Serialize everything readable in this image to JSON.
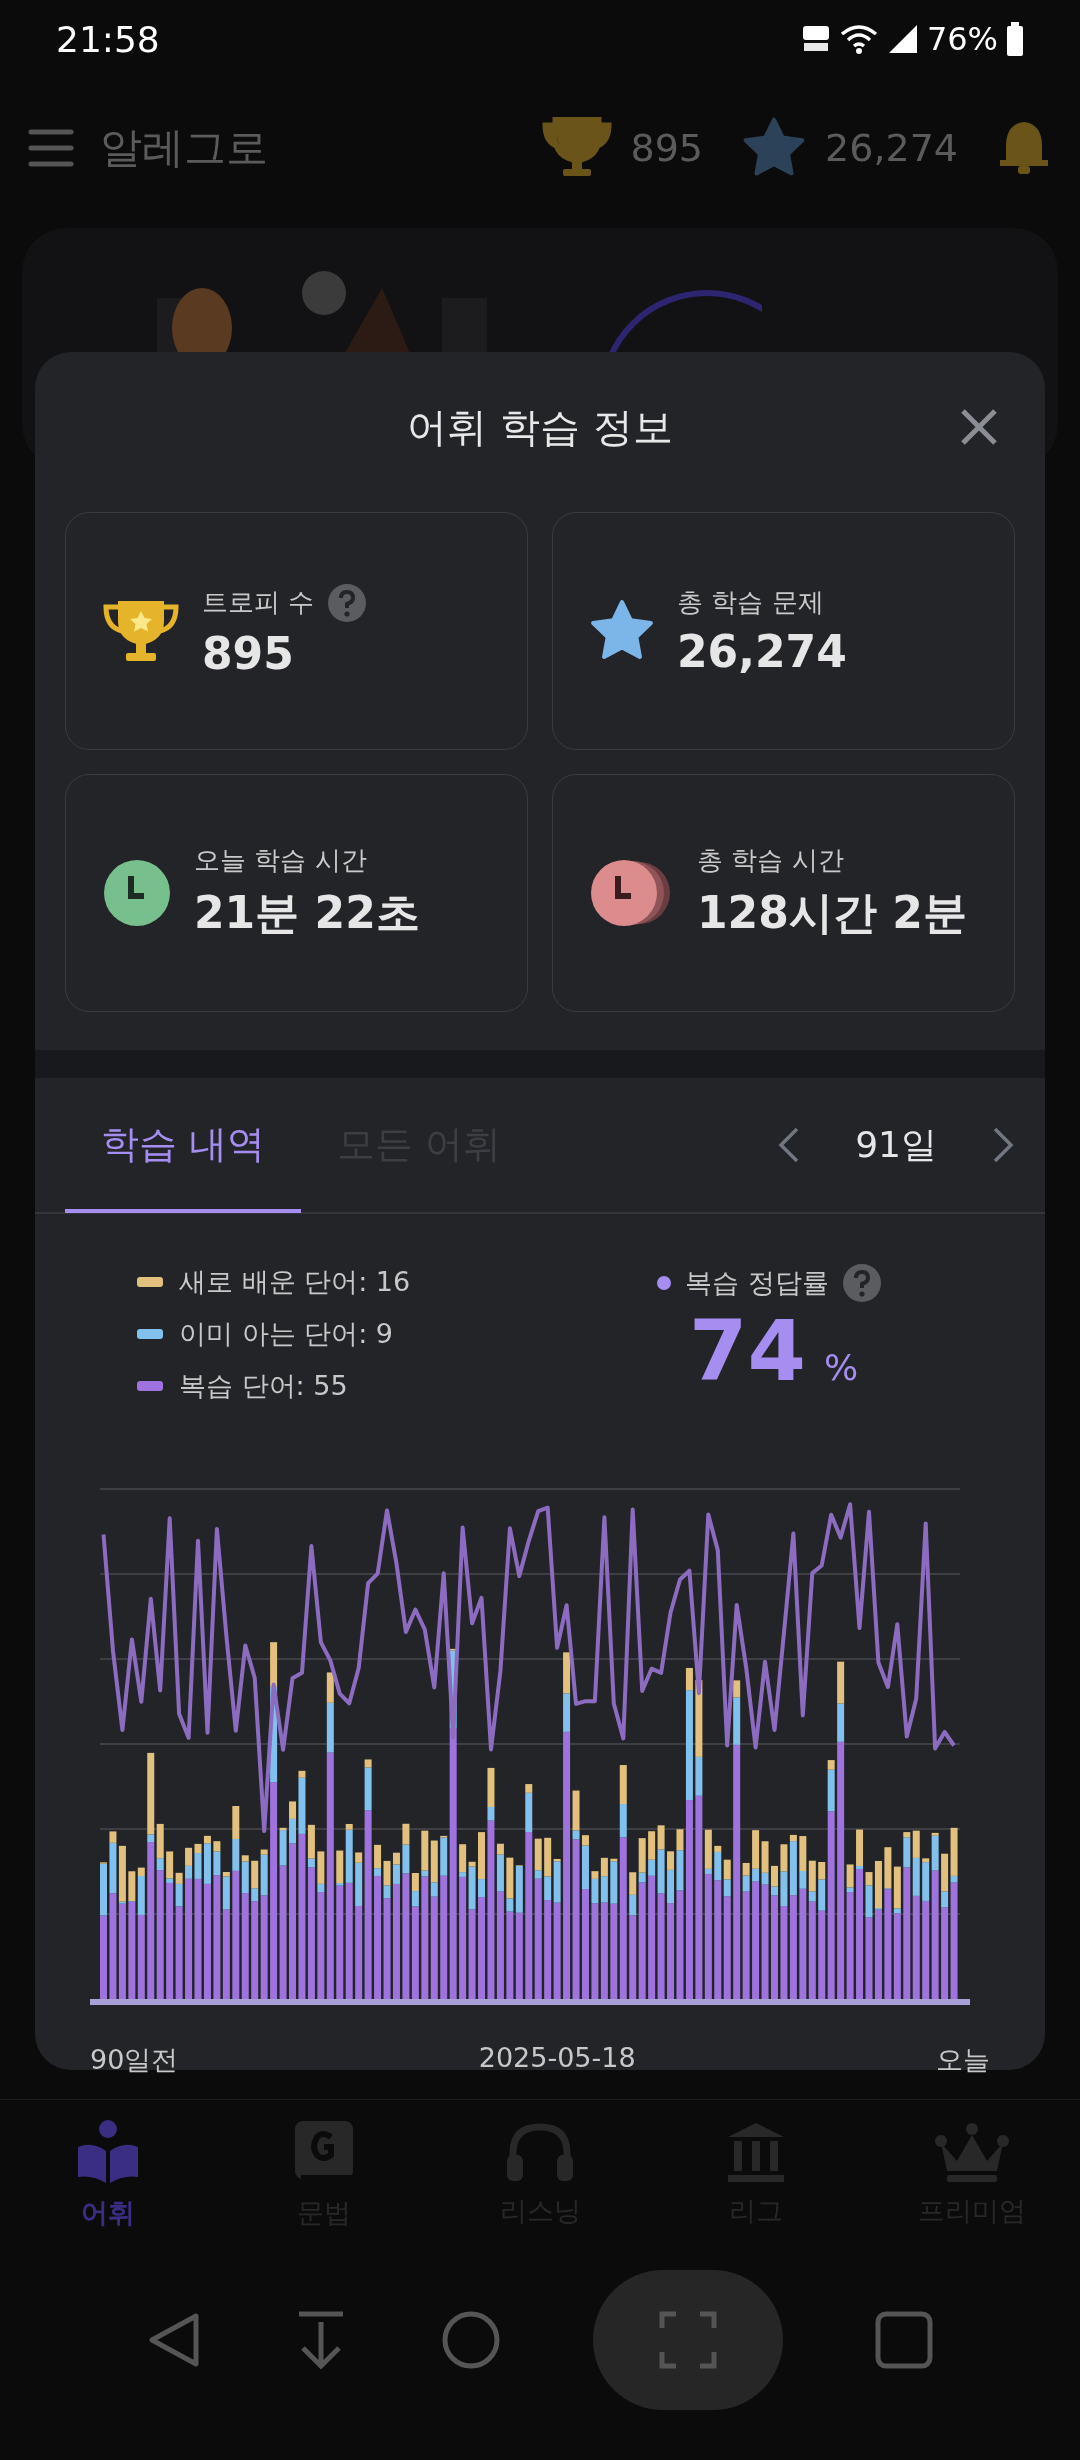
{
  "status_bar": {
    "time": "21:58",
    "battery": "76%"
  },
  "app_bar": {
    "title": "알레그로",
    "trophies": "895",
    "stars": "26,274"
  },
  "modal": {
    "title": "어휘 학습 정보",
    "stat_cards": [
      {
        "kind": "trophy",
        "label": "트로피 수",
        "value": "895",
        "has_help": true
      },
      {
        "kind": "star",
        "label": "총 학습 문제",
        "value": "26,274",
        "has_help": false
      },
      {
        "kind": "clock",
        "label": "오늘 학습 시간",
        "value": "21분 22초",
        "has_help": false
      },
      {
        "kind": "clocks",
        "label": "총 학습 시간",
        "value": "128시간 2분",
        "has_help": false
      }
    ],
    "tabs": [
      {
        "label": "학습 내역",
        "selected": true
      },
      {
        "label": "모든 어휘",
        "selected": false
      }
    ],
    "period": "91일",
    "legend": [
      {
        "label": "새로 배운 단어: 16",
        "color": "#e2c17f"
      },
      {
        "label": "이미 아는 단어: 9",
        "color": "#82c0ee"
      },
      {
        "label": "복습 단어: 55",
        "color": "#9e73de"
      }
    ],
    "accuracy": {
      "label": "복습 정답률",
      "value": "74",
      "unit": "%"
    },
    "x_labels": [
      "90일전",
      "2025-05-18",
      "오늘"
    ]
  },
  "bottom_nav": [
    {
      "kind": "vocab",
      "label": "어휘",
      "selected": true
    },
    {
      "kind": "grammar",
      "label": "문법",
      "selected": false
    },
    {
      "kind": "listening",
      "label": "리스닝",
      "selected": false
    },
    {
      "kind": "league",
      "label": "리그",
      "selected": false
    },
    {
      "kind": "premium",
      "label": "프리미엄",
      "selected": false
    }
  ]
}
